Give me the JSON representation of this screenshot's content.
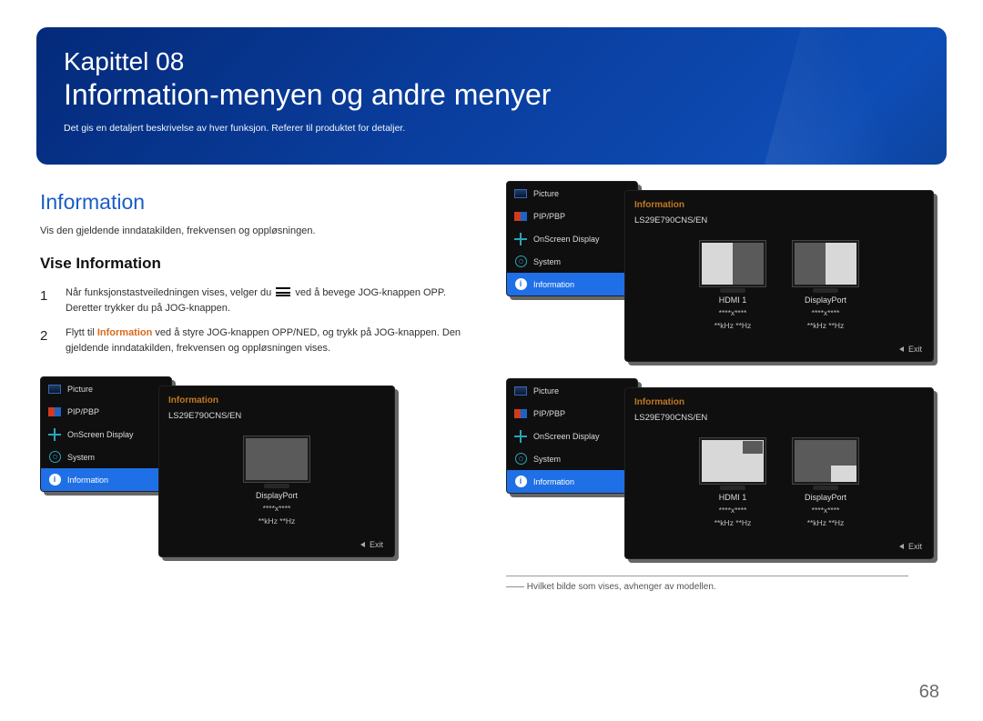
{
  "banner": {
    "chapter": "Kapittel 08",
    "title": "Information-menyen og andre menyer",
    "subtitle": "Det gis en detaljert beskrivelse av hver funksjon. Referer til produktet for detaljer."
  },
  "section_heading": "Information",
  "section_desc": "Vis den gjeldende inndatakilden, frekvensen og oppløsningen.",
  "subsection_heading": "Vise Information",
  "steps": {
    "s1a": "Når funksjonstastveiledningen vises, velger du ",
    "s1b": " ved å bevege JOG-knappen OPP. Deretter trykker du på JOG-knappen.",
    "s2a": "Flytt til ",
    "s2kw": "Information",
    "s2b": " ved å styre JOG-knappen OPP/NED, og trykk på JOG-knappen. Den gjeldende inndatakilden, frekvensen og oppløsningen vises."
  },
  "osd": {
    "menu_items": {
      "picture": "Picture",
      "pip": "PIP/PBP",
      "osd": "OnScreen Display",
      "system": "System",
      "info": "Information"
    },
    "panel_title": "Information",
    "model": "LS29E790CNS/EN",
    "src": {
      "hdmi1": "HDMI 1",
      "displayport": "DisplayPort",
      "res": "****x****",
      "freq": "**kHz **Hz"
    },
    "exit": "Exit"
  },
  "footnote": "―― Hvilket bilde som vises, avhenger av modellen.",
  "page_number": "68"
}
